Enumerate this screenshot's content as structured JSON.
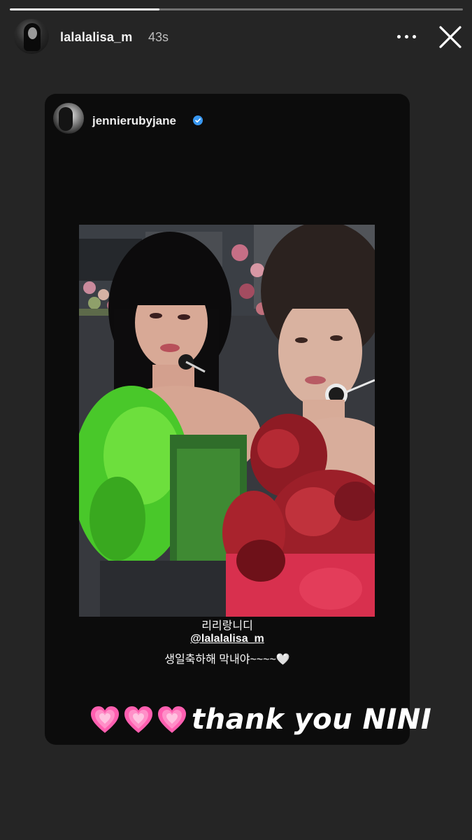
{
  "story": {
    "progress": 0.33,
    "username": "lalalalisa_m",
    "time_ago": "43s"
  },
  "shared_post": {
    "username": "jennierubyjane",
    "verified": true,
    "caption_line1": "리리랑니디",
    "caption_mention": "@lalalalisa_m",
    "caption_line3": "생일축하해 막내야~~~~🤍"
  },
  "sticker": {
    "emoji": "💗",
    "count": 3,
    "text": "thank you NINI"
  },
  "colors": {
    "background": "#252525",
    "card": "#0c0c0c",
    "verified": "#3897f0",
    "heart": "#ff5fb0"
  }
}
